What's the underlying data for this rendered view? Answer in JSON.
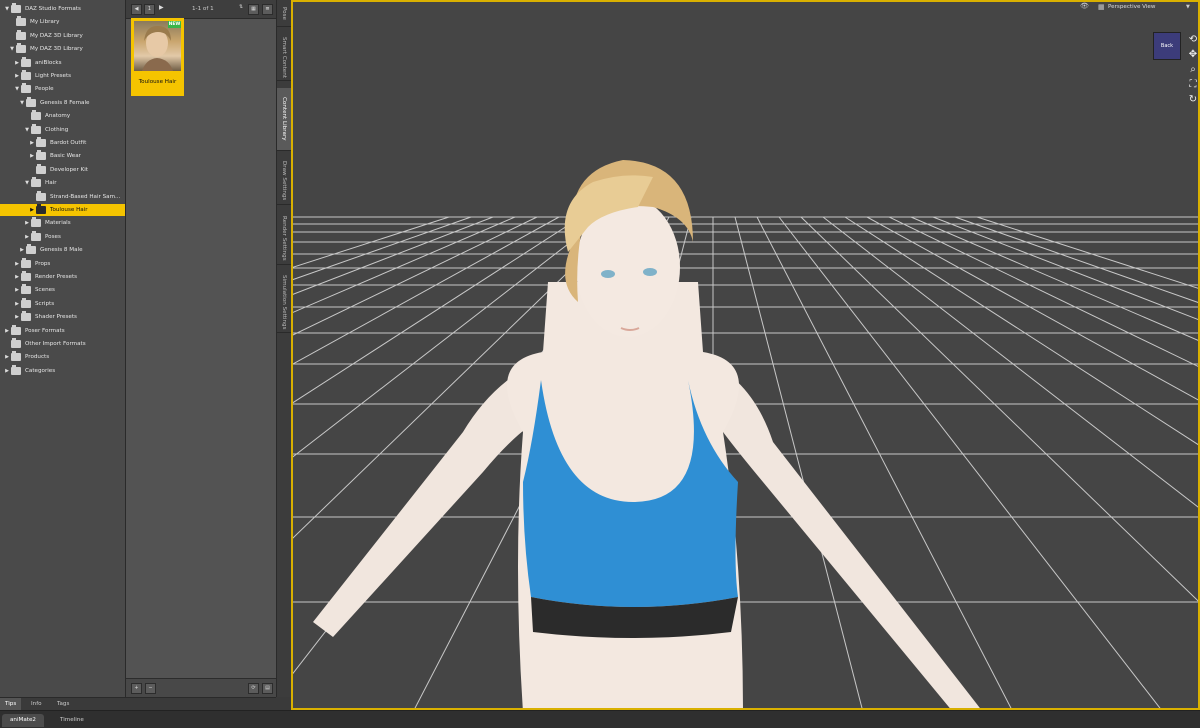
{
  "library_tree": {
    "rows": [
      {
        "label": "DAZ Studio Formats",
        "level": 0,
        "expanded": true,
        "header": true
      },
      {
        "label": "My Library",
        "level": 1
      },
      {
        "label": "My DAZ 3D Library",
        "level": 1
      },
      {
        "label": "My DAZ 3D Library",
        "level": 1,
        "expanded": true
      },
      {
        "label": "aniBlocks",
        "level": 2,
        "collapsed": true
      },
      {
        "label": "Light Presets",
        "level": 2,
        "collapsed": true
      },
      {
        "label": "People",
        "level": 2,
        "expanded": true
      },
      {
        "label": "Genesis 8 Female",
        "level": 3,
        "expanded": true
      },
      {
        "label": "Anatomy",
        "level": 4
      },
      {
        "label": "Clothing",
        "level": 4,
        "expanded": true
      },
      {
        "label": "Bardot Outfit",
        "level": 5,
        "collapsed": true
      },
      {
        "label": "Basic Wear",
        "level": 5,
        "collapsed": true
      },
      {
        "label": "Developer Kit",
        "level": 5
      },
      {
        "label": "Hair",
        "level": 4,
        "expanded": true
      },
      {
        "label": "Strand-Based Hair Sam...",
        "level": 5
      },
      {
        "label": "Toulouse Hair",
        "level": 5,
        "collapsed": true,
        "selected": true
      },
      {
        "label": "Materials",
        "level": 4,
        "collapsed": true
      },
      {
        "label": "Poses",
        "level": 4,
        "collapsed": true
      },
      {
        "label": "Genesis 8 Male",
        "level": 3,
        "collapsed": true
      },
      {
        "label": "Props",
        "level": 2,
        "collapsed": true
      },
      {
        "label": "Render Presets",
        "level": 2,
        "collapsed": true
      },
      {
        "label": "Scenes",
        "level": 2,
        "collapsed": true
      },
      {
        "label": "Scripts",
        "level": 2,
        "collapsed": true
      },
      {
        "label": "Shader Presets",
        "level": 2,
        "collapsed": true
      },
      {
        "label": "Poser Formats",
        "level": 0,
        "collapsed": true
      },
      {
        "label": "Other Import Formats",
        "level": 0
      },
      {
        "label": "Products",
        "level": 0,
        "collapsed": true
      },
      {
        "label": "Categories",
        "level": 0,
        "collapsed": true
      }
    ]
  },
  "content_grid": {
    "page": "1",
    "count": "1-1 of 1",
    "tile": {
      "label": "Toulouse Hair",
      "badge": "NEW"
    },
    "add_label": "+",
    "remove_label": "−"
  },
  "side_tabs": [
    "Pose",
    "Smart Content",
    "Content Library",
    "Draw Settings",
    "Render Settings",
    "Simulation Settings"
  ],
  "side_tab_active": "Content Library",
  "left_bottom_tabs": [
    "Tips",
    "Info",
    "Tags"
  ],
  "viewport": {
    "view_name": "Perspective View",
    "cube_label": "Back"
  },
  "bottom_tabs": [
    "aniMate2",
    "Timeline"
  ],
  "colors": {
    "accent": "#f5c400",
    "viewport_bg": "#454545",
    "panel_bg": "#4a4a4a",
    "grid_line": "#c8c8c8"
  }
}
